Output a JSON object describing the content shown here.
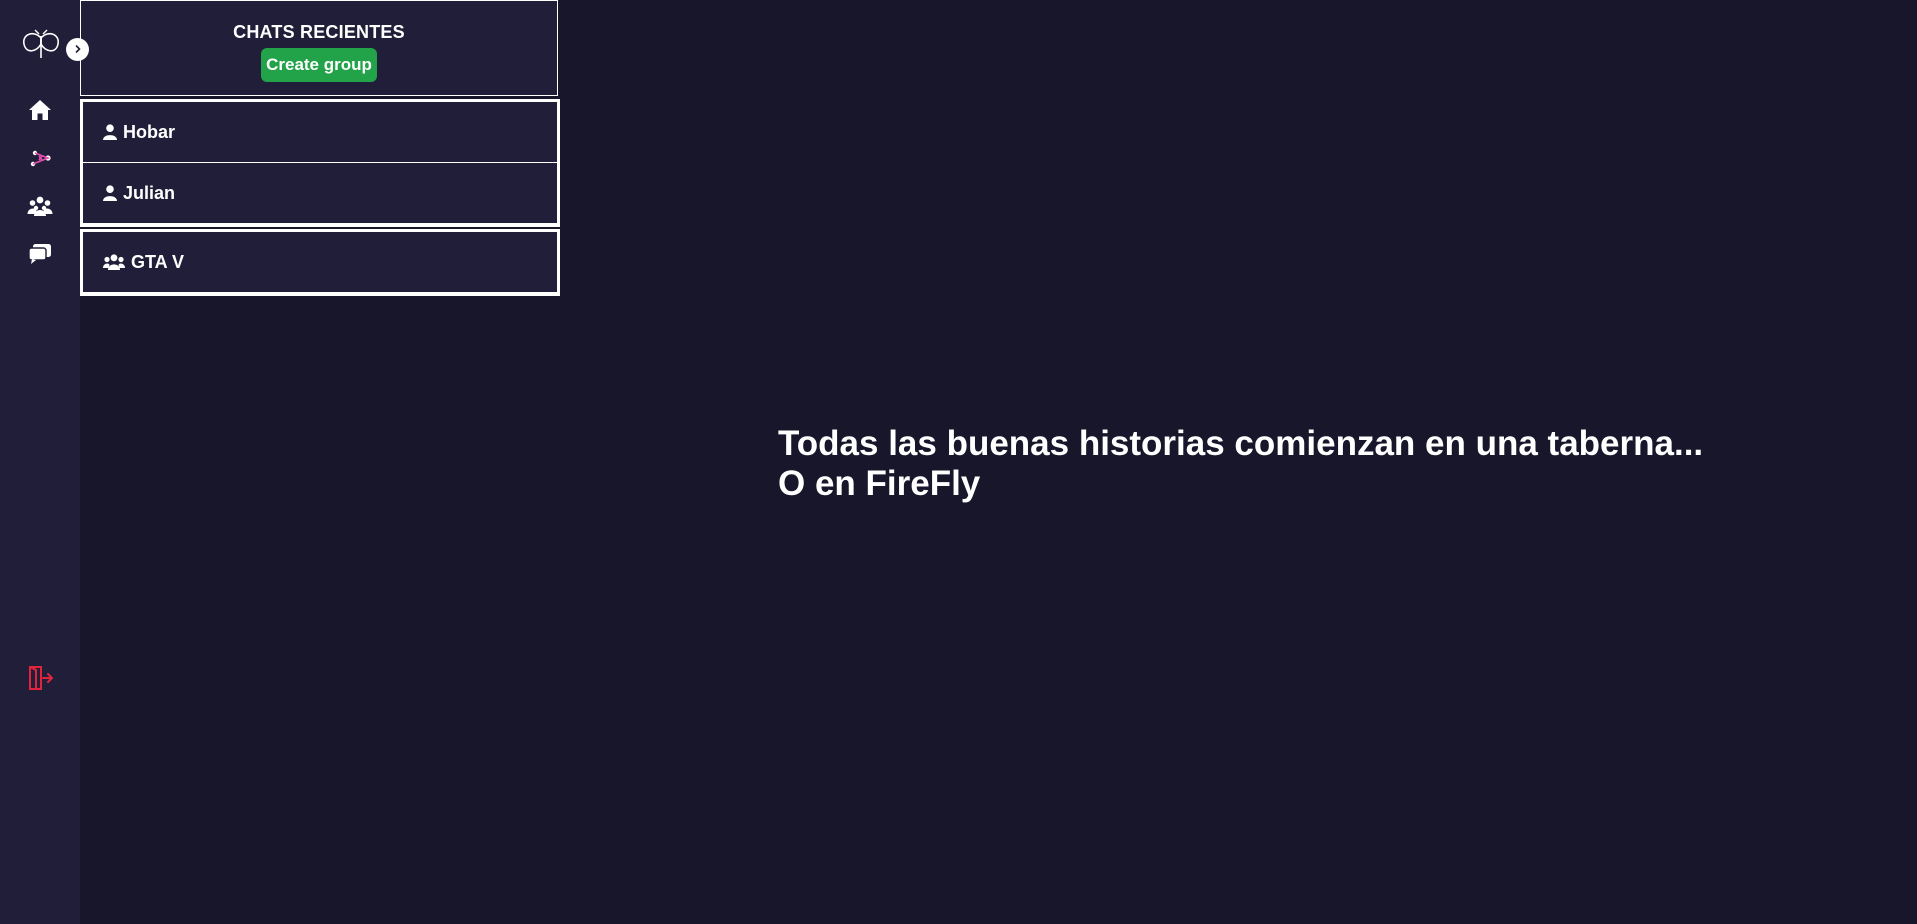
{
  "sidebar": {
    "logo": "firefly-logo-icon",
    "expand_icon": "chevron-right-icon",
    "nav": [
      {
        "name": "home",
        "icon": "home-icon"
      },
      {
        "name": "match",
        "icon": "sparkle-connect-icon"
      },
      {
        "name": "groups",
        "icon": "users-icon"
      },
      {
        "name": "chats",
        "icon": "comments-icon"
      }
    ],
    "logout_icon": "logout-icon",
    "logout_color": "#e0243c"
  },
  "chats_panel": {
    "title": "CHATS RECIENTES",
    "create_group_label": "Create group",
    "create_group_color": "#22a34a",
    "direct_chats": [
      {
        "label": "Hobar",
        "icon": "user-icon"
      },
      {
        "label": "Julian",
        "icon": "user-icon"
      }
    ],
    "group_chats": [
      {
        "label": "GTA V",
        "icon": "group-icon"
      }
    ]
  },
  "main": {
    "line1": "Todas las buenas historias comienzan en una taberna...",
    "line2": "O en FireFly"
  }
}
